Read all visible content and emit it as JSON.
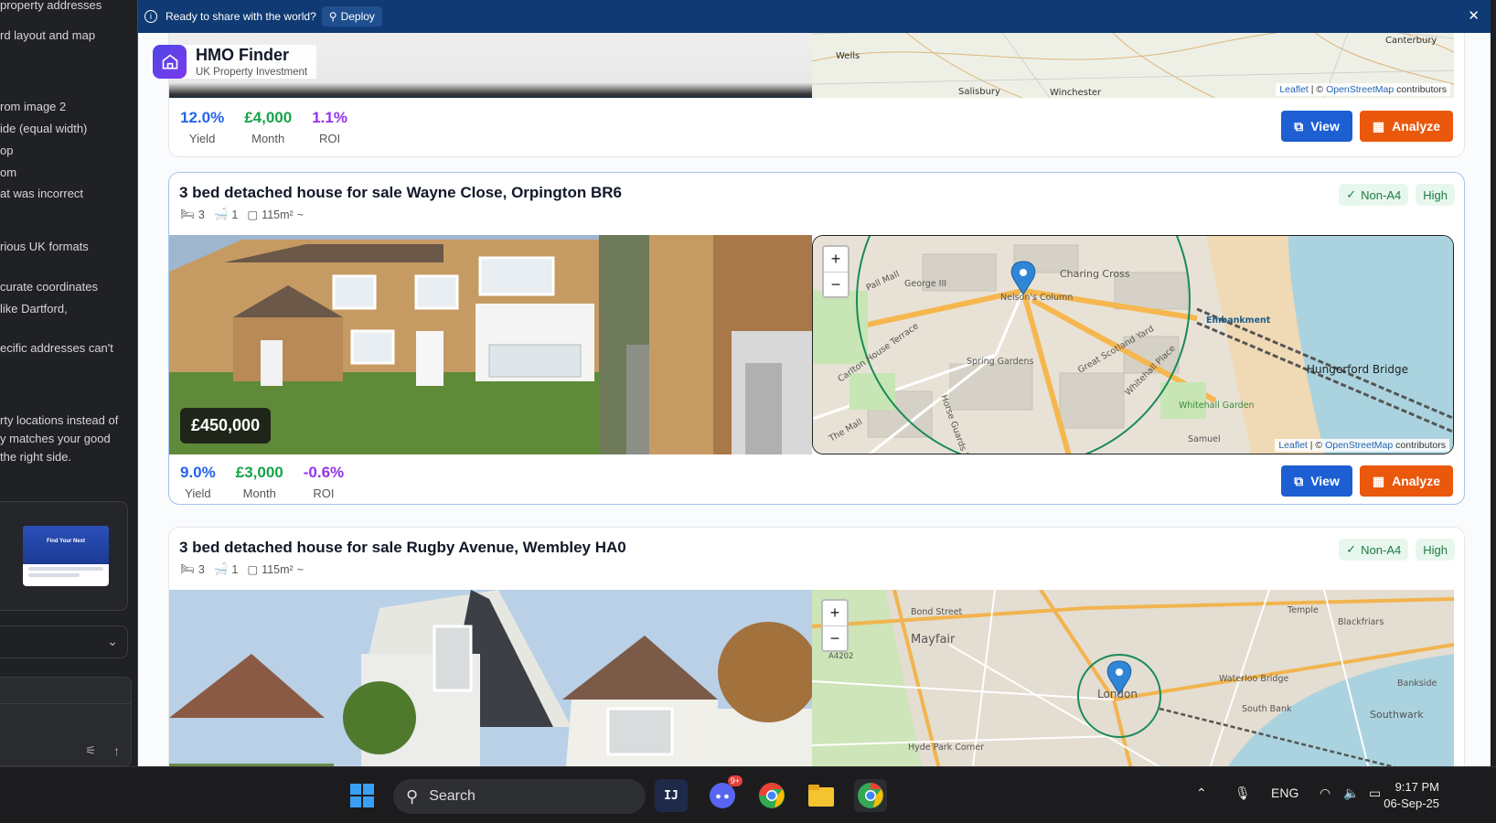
{
  "chat": {
    "lines": [
      "property addresses",
      "rd layout and map",
      "rom image 2",
      "ide (equal width)",
      "op",
      "om",
      "at was incorrect",
      "rious UK formats",
      "curate coordinates",
      "like Dartford,",
      "ecific addresses can't",
      "rty locations instead of",
      "y matches your good",
      "the right side."
    ],
    "thumbnail_text": "Find Your Next"
  },
  "deploy_bar": {
    "message": "Ready to share with the world?",
    "button": "Deploy"
  },
  "app": {
    "name": "HMO Finder",
    "subtitle": "UK Property Investment"
  },
  "map_attribution": {
    "leaflet": "Leaflet",
    "separator": " | © ",
    "osm": "OpenStreetMap",
    "suffix": " contributors"
  },
  "map_labels_1": [
    "Wells",
    "Salisbury",
    "Winchester",
    "Canterbury"
  ],
  "map_labels_2": [
    "George III",
    "Pall Mall",
    "Nelson's Column",
    "Charing Cross",
    "Embankment",
    "Hungerford Bridge",
    "Carlton House Terrace",
    "The Mall",
    "Spring Gardens",
    "Great Scotland Yard",
    "Whitehall Place",
    "Whitehall Garden",
    "Horse Guards Road",
    "Samuel"
  ],
  "map_labels_3": [
    "Bond Street",
    "Mayfair",
    "A4202",
    "London",
    "Waterloo Bridge",
    "South Bank",
    "Blackfriars",
    "Temple",
    "Bankside",
    "Southwark",
    "Hyde Park Corner"
  ],
  "listings": [
    {
      "stats": {
        "yield": "12.0%",
        "yield_label": "Yield",
        "month": "£4,000",
        "month_label": "Month",
        "roi": "1.1%",
        "roi_label": "ROI"
      },
      "view": "View",
      "analyze": "Analyze"
    },
    {
      "title": "3 bed detached house for sale Wayne Close, Orpington BR6",
      "beds": "3",
      "baths": "1",
      "area": "115m²",
      "tilde": "~",
      "badge_type": "Non-A4",
      "badge_level": "High",
      "price": "£450,000",
      "stats": {
        "yield": "9.0%",
        "yield_label": "Yield",
        "month": "£3,000",
        "month_label": "Month",
        "roi": "-0.6%",
        "roi_label": "ROI"
      },
      "view": "View",
      "analyze": "Analyze"
    },
    {
      "title": "3 bed detached house for sale Rugby Avenue, Wembley HA0",
      "beds": "3",
      "baths": "1",
      "area": "115m²",
      "tilde": "~",
      "badge_type": "Non-A4",
      "badge_level": "High"
    }
  ],
  "taskbar": {
    "search": "Search",
    "discord_badge": "9+",
    "lang": "ENG",
    "time": "9:17 PM",
    "date": "06-Sep-25"
  }
}
